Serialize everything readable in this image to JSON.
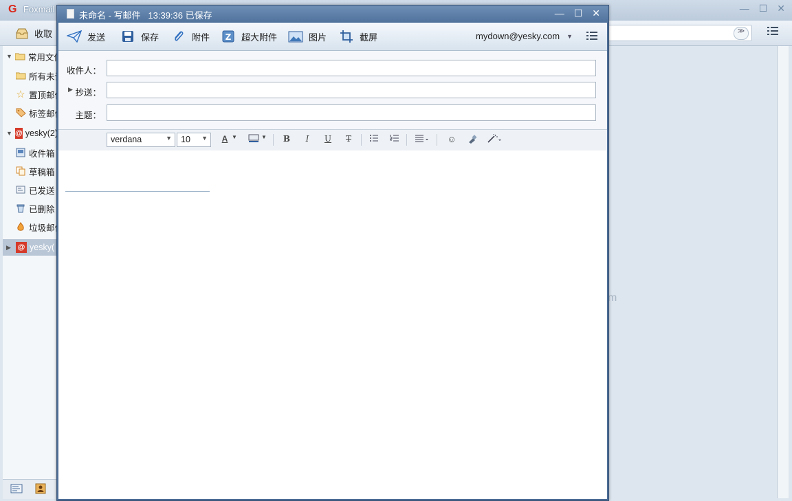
{
  "main": {
    "app_title": "Foxmail",
    "toolbar": {
      "receive_label": "收取"
    },
    "sidebar": {
      "items": [
        {
          "label": "常用文件夹",
          "icon": "folder-icon"
        },
        {
          "label": "所有未读",
          "icon": "folder-icon"
        },
        {
          "label": "置顶邮件",
          "icon": "star-icon"
        },
        {
          "label": "标签邮件",
          "icon": "tag-icon"
        },
        {
          "label": "yesky(2)",
          "icon": "at-account-icon"
        },
        {
          "label": "收件箱",
          "icon": "inbox-icon"
        },
        {
          "label": "草稿箱",
          "icon": "drafts-icon"
        },
        {
          "label": "已发送",
          "icon": "sent-icon"
        },
        {
          "label": "已删除",
          "icon": "trash-icon"
        },
        {
          "label": "垃圾邮件",
          "icon": "junk-icon"
        },
        {
          "label": "yesky(",
          "icon": "at-account-icon"
        }
      ]
    },
    "watermark": "m"
  },
  "compose": {
    "title": "未命名 - 写邮件   13:39:36 已保存",
    "toolbar": {
      "send": "发送",
      "save": "保存",
      "attach": "附件",
      "big_attach": "超大附件",
      "image": "图片",
      "screenshot": "截屏"
    },
    "account": "mydown@yesky.com",
    "fields": {
      "to_label": "收件人：",
      "cc_label": "抄送：",
      "subject_label": "主题：",
      "to_value": "",
      "cc_value": "",
      "subject_value": ""
    },
    "format": {
      "font": "verdana",
      "size": "10",
      "bold": "B",
      "italic": "I",
      "underline": "U",
      "strike": "T"
    }
  },
  "colors": {
    "compose_frame": "#4c6d95",
    "send_accent": "#2f6fc0",
    "logo_red": "#d8281c"
  }
}
